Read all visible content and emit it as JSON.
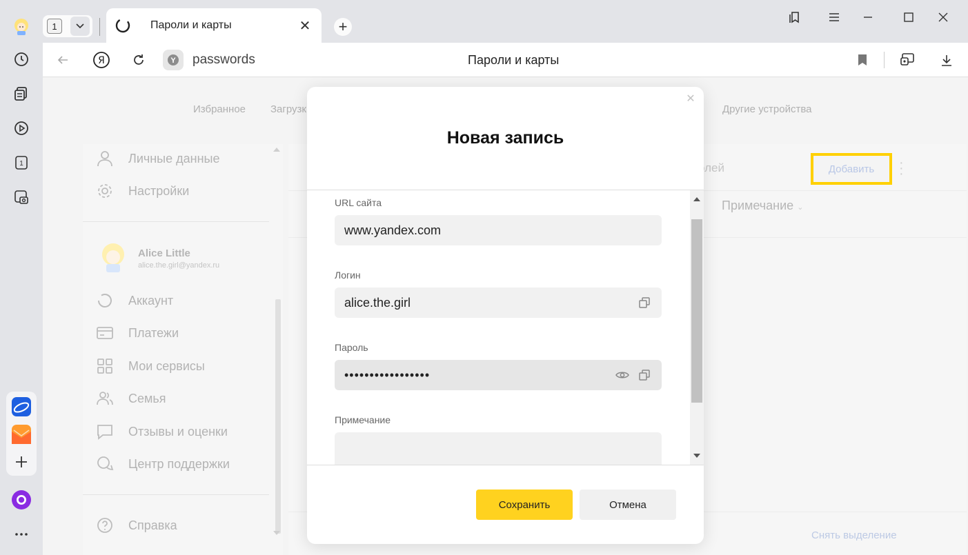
{
  "browser": {
    "tab_count": "1",
    "active_tab_title": "Пароли и карты",
    "address_text": "passwords",
    "page_title": "Пароли и карты"
  },
  "page": {
    "top_nav": [
      "Избранное",
      "Загрузк",
      "Другие устройства"
    ],
    "left_menu_top": [
      {
        "label": "Личные данные",
        "icon": "person-icon"
      },
      {
        "label": "Настройки",
        "icon": "gear-icon"
      }
    ],
    "user": {
      "name": "Alice Little",
      "email": "alice.the.girl@yandex.ru"
    },
    "left_menu_account": [
      {
        "label": "Аккаунт",
        "icon": "account-icon"
      },
      {
        "label": "Платежи",
        "icon": "card-icon"
      },
      {
        "label": "Мои сервисы",
        "icon": "grid-icon"
      },
      {
        "label": "Семья",
        "icon": "family-icon"
      },
      {
        "label": "Отзывы и оценки",
        "icon": "comment-icon"
      },
      {
        "label": "Центр поддержки",
        "icon": "support-icon"
      }
    ],
    "help_label": "Справка",
    "search_placeholder_fragment": "олей",
    "add_button": "Добавить",
    "column_note": "Примечание",
    "unselect_label": "Снять выделение"
  },
  "modal": {
    "title": "Новая запись",
    "fields": {
      "url_label": "URL сайта",
      "url_value": "www.yandex.com",
      "login_label": "Логин",
      "login_value": "alice.the.girl",
      "password_label": "Пароль",
      "password_value": "•••••••••••••••••",
      "note_label": "Примечание",
      "note_value": ""
    },
    "save_label": "Сохранить",
    "cancel_label": "Отмена"
  },
  "colors": {
    "accent_yellow": "#ffd21f",
    "highlight_border": "#ffd000",
    "alice_purple": "#8a2be2"
  }
}
